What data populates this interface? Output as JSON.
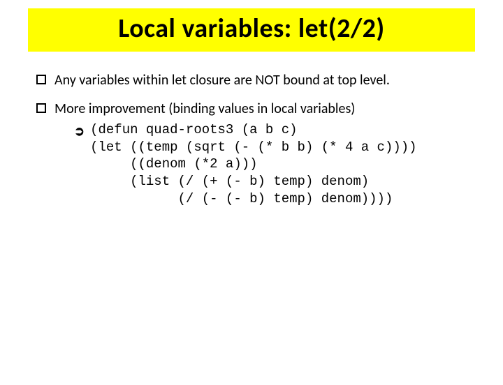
{
  "title": "Local variables: let(2/2)",
  "bullets": [
    {
      "text": "Any variables within let closure are NOT bound at top level."
    },
    {
      "text": "More improvement (binding values in local variables)"
    }
  ],
  "code_lines": [
    "(defun quad-roots3 (a b c)",
    "(let ((temp (sqrt (- (* b b) (* 4 a c))))",
    "     ((denom (*2 a)))",
    "     (list (/ (+ (- b) temp) denom)",
    "           (/ (- (- b) temp) denom))))"
  ],
  "arrow_glyph": "➲"
}
